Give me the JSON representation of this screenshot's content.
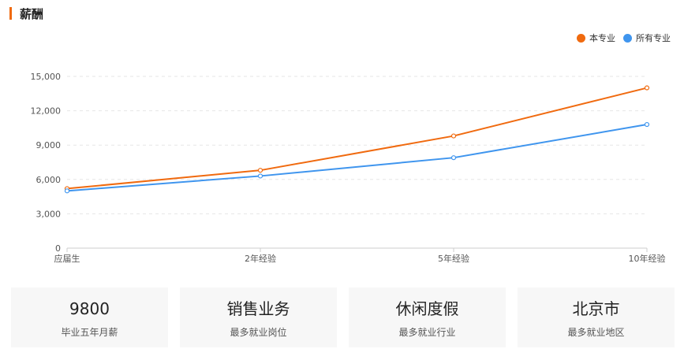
{
  "section": {
    "title": "薪酬"
  },
  "colors": {
    "accent": "#f06a0f",
    "series_major": "#f06a0f",
    "series_all": "#3f95ee"
  },
  "chart_data": {
    "type": "line",
    "categories": [
      "应届生",
      "2年经验",
      "5年经验",
      "10年经验"
    ],
    "series": [
      {
        "name": "本专业",
        "values": [
          5200,
          6800,
          9800,
          14000
        ],
        "color": "#f06a0f"
      },
      {
        "name": "所有专业",
        "values": [
          5000,
          6300,
          7900,
          10800
        ],
        "color": "#3f95ee"
      }
    ],
    "ylim": [
      0,
      15000
    ],
    "yticks": [
      0,
      3000,
      6000,
      9000,
      12000,
      15000
    ],
    "ytick_labels": [
      "0",
      "3,000",
      "6,000",
      "9,000",
      "12,000",
      "15,000"
    ],
    "legend_position": "top-right",
    "grid": true
  },
  "cards": [
    {
      "value": "9800",
      "label": "毕业五年月薪"
    },
    {
      "value": "销售业务",
      "label": "最多就业岗位"
    },
    {
      "value": "休闲度假",
      "label": "最多就业行业"
    },
    {
      "value": "北京市",
      "label": "最多就业地区"
    }
  ]
}
